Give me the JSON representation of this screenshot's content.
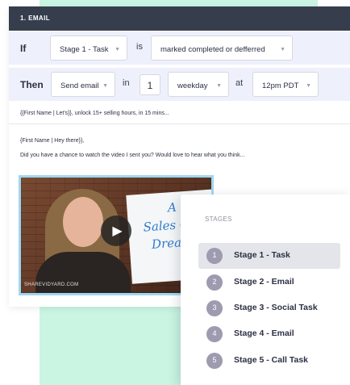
{
  "email_card": {
    "header_title": "1. EMAIL",
    "if_row": {
      "label": "If",
      "stage_select": "Stage 1 - Task",
      "is_word": "is",
      "status_select": "marked completed or defferred"
    },
    "then_row": {
      "label": "Then",
      "action_select": "Send email",
      "in_word": "in",
      "delay_value": "1",
      "unit_select": "weekday",
      "at_word": "at",
      "time_select": "12pm PDT"
    },
    "subject": "{{First Name | Let's}}, unlock 15+ selling hours, in 15 mins...",
    "greeting": "{First Name | Hey there}},",
    "body": "Did you have a chance to watch the video I sent you? Would love to hear what you think...",
    "video": {
      "board_text": [
        "A",
        "Sales Ops",
        "Dream!"
      ],
      "watermark": "SHAREVIDYARD.COM"
    }
  },
  "stage_dropdown": {
    "heading": "STAGES",
    "selected_index": 0,
    "items": [
      {
        "number": "1",
        "label": "Stage 1 - Task"
      },
      {
        "number": "2",
        "label": "Stage 2 - Email"
      },
      {
        "number": "3",
        "label": "Stage 3 - Social Task"
      },
      {
        "number": "4",
        "label": "Stage 4 - Email"
      },
      {
        "number": "5",
        "label": "Stage 5 - Call Task"
      }
    ]
  },
  "icons": {
    "caret": "chevron-down-icon",
    "play": "play-icon"
  },
  "colors": {
    "header_bg": "#363e4d",
    "row_bg": "#eef0fb",
    "mint_bg": "#c9f5e2",
    "video_border": "#9fd7ef",
    "stage_badge": "#9e9aaf"
  }
}
